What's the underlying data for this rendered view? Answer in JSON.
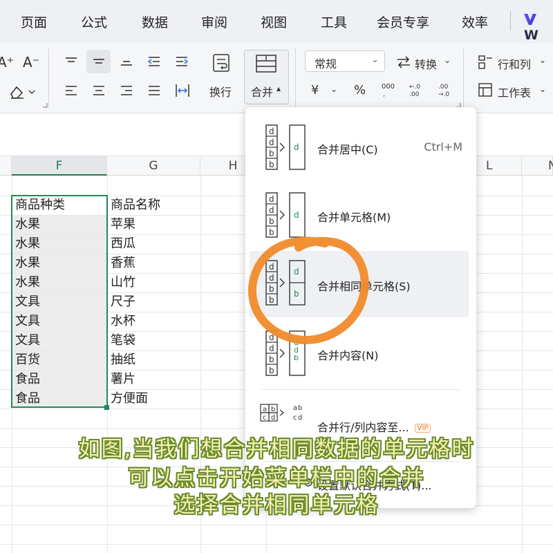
{
  "menu": {
    "items": [
      "页面",
      "公式",
      "数据",
      "审阅",
      "视图",
      "工具",
      "会员专享",
      "效率"
    ],
    "brand": "W"
  },
  "ribbon": {
    "font_increase": "A⁺",
    "font_decrease": "A⁻",
    "wrap_label": "换行",
    "merge_label": "合并",
    "number_format": "常规",
    "convert_label": "转换",
    "currency_symbol": "¥",
    "percent_symbol": "%",
    "rows_cols_label": "行和列",
    "worksheet_label": "工作表"
  },
  "grid": {
    "columns": [
      "F",
      "G",
      "H",
      "L",
      "N"
    ],
    "rows": [
      [
        "商品种类",
        "商品名称"
      ],
      [
        "水果",
        "苹果"
      ],
      [
        "水果",
        "西瓜"
      ],
      [
        "水果",
        "香蕉"
      ],
      [
        "水果",
        "山竹"
      ],
      [
        "文具",
        "尺子"
      ],
      [
        "文具",
        "水杯"
      ],
      [
        "文具",
        "笔袋"
      ],
      [
        "百货",
        "抽纸"
      ],
      [
        "食品",
        "薯片"
      ],
      [
        "食品",
        "方便面"
      ]
    ]
  },
  "merge_menu": {
    "items": [
      {
        "label": "合并居中(C)",
        "shortcut": "Ctrl+M"
      },
      {
        "label": "合并单元格(M)",
        "shortcut": ""
      },
      {
        "label": "合并相同单元格(S)",
        "shortcut": ""
      },
      {
        "label": "合并内容(N)",
        "shortcut": ""
      },
      {
        "label": "合并行/列内容至...",
        "badge": "VIP"
      },
      {
        "label": "设置默认合并方式(T)..."
      }
    ],
    "icon_letters": {
      "a": "a",
      "b": "b",
      "c": "c",
      "d": "d"
    }
  },
  "annotation": {
    "lines": [
      "如图,当我们想合并相同数据的单元格时",
      "可以点击开始菜单栏中的合并",
      "选择合并相同单元格"
    ],
    "highlight_color": "#f08a2a"
  }
}
